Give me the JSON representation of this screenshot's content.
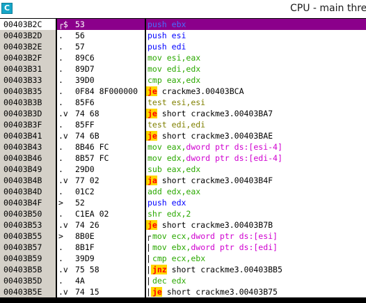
{
  "window": {
    "title": "CPU - main thre",
    "icon_letter": "C"
  },
  "rows": [
    {
      "addr": "00403B2C",
      "marker": "┌$",
      "hex": "53",
      "mnem": "push",
      "ops": "ebx",
      "color": "blue",
      "selected": true
    },
    {
      "addr": "00403B2D",
      "marker": ".",
      "hex": "56",
      "mnem": "push",
      "ops": "esi",
      "color": "blue"
    },
    {
      "addr": "00403B2E",
      "marker": ".",
      "hex": "57",
      "mnem": "push",
      "ops": "edi",
      "color": "blue"
    },
    {
      "addr": "00403B2F",
      "marker": ".",
      "hex": "89C6",
      "mnem": "mov",
      "ops": "esi,eax",
      "color": "green"
    },
    {
      "addr": "00403B31",
      "marker": ".",
      "hex": "89D7",
      "mnem": "mov",
      "ops": "edi,edx",
      "color": "green"
    },
    {
      "addr": "00403B33",
      "marker": ".",
      "hex": "39D0",
      "mnem": "cmp",
      "ops": "eax,edx",
      "color": "green"
    },
    {
      "addr": "00403B35",
      "marker": ".",
      "hex": "0F84 8F000000",
      "mnem": "je",
      "ops": "crackme3.00403BCA",
      "jump": true
    },
    {
      "addr": "00403B3B",
      "marker": ".",
      "hex": "85F6",
      "mnem": "test",
      "ops": "esi,esi",
      "color": "olive"
    },
    {
      "addr": "00403B3D",
      "marker": ".v",
      "hex": "74 68",
      "mnem": "je",
      "ops": "short crackme3.00403BA7",
      "jump": true
    },
    {
      "addr": "00403B3F",
      "marker": ".",
      "hex": "85FF",
      "mnem": "test",
      "ops": "edi,edi",
      "color": "olive"
    },
    {
      "addr": "00403B41",
      "marker": ".v",
      "hex": "74 6B",
      "mnem": "je",
      "ops": "short crackme3.00403BAE",
      "jump": true
    },
    {
      "addr": "00403B43",
      "marker": ".",
      "hex": "8B46 FC",
      "mnem": "mov",
      "ops": "eax,",
      "mem": "dword ptr ds:[esi-4]",
      "color": "green"
    },
    {
      "addr": "00403B46",
      "marker": ".",
      "hex": "8B57 FC",
      "mnem": "mov",
      "ops": "edx,",
      "mem": "dword ptr ds:[edi-4]",
      "color": "green"
    },
    {
      "addr": "00403B49",
      "marker": ".",
      "hex": "29D0",
      "mnem": "sub",
      "ops": "eax,edx",
      "color": "green"
    },
    {
      "addr": "00403B4B",
      "marker": ".v",
      "hex": "77 02",
      "mnem": "ja",
      "ops": "short crackme3.00403B4F",
      "jump": true
    },
    {
      "addr": "00403B4D",
      "marker": ".",
      "hex": "01C2",
      "mnem": "add",
      "ops": "edx,eax",
      "color": "green"
    },
    {
      "addr": "00403B4F",
      "marker": ">",
      "hex": "52",
      "mnem": "push",
      "ops": "edx",
      "color": "blue"
    },
    {
      "addr": "00403B50",
      "marker": ".",
      "hex": "C1EA 02",
      "mnem": "shr",
      "ops": "edx,2",
      "color": "green"
    },
    {
      "addr": "00403B53",
      "marker": ".v",
      "hex": "74 26",
      "mnem": "je",
      "ops": "short crackme3.00403B7B",
      "jump": true
    },
    {
      "addr": "00403B55",
      "marker": ">",
      "hex": "8B0E",
      "mnem": "mov",
      "ops": "ecx,",
      "mem": "dword ptr ds:[esi]",
      "color": "green",
      "indent": "┌"
    },
    {
      "addr": "00403B57",
      "marker": ".",
      "hex": "8B1F",
      "mnem": "mov",
      "ops": "ebx,",
      "mem": "dword ptr ds:[edi]",
      "color": "green",
      "indent": "|"
    },
    {
      "addr": "00403B59",
      "marker": ".",
      "hex": "39D9",
      "mnem": "cmp",
      "ops": "ecx,ebx",
      "color": "green",
      "indent": "|"
    },
    {
      "addr": "00403B5B",
      "marker": ".v",
      "hex": "75 58",
      "mnem": "jnz",
      "ops": "short crackme3.00403BB5",
      "jump": true,
      "indent": "|"
    },
    {
      "addr": "00403B5D",
      "marker": ".",
      "hex": "4A",
      "mnem": "dec",
      "ops": "edx",
      "color": "green",
      "indent": "|"
    },
    {
      "addr": "00403B5E",
      "marker": ".v",
      "hex": "74 15",
      "mnem": "je",
      "ops": "short crackme3.00403B75",
      "jump": true,
      "indent": "|"
    }
  ]
}
